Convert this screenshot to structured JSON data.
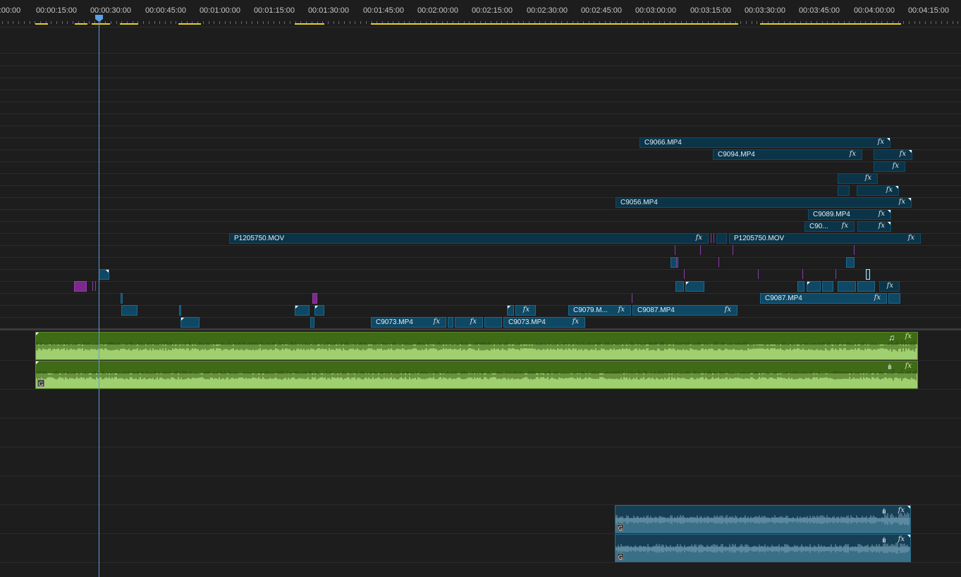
{
  "ruler": {
    "labels": [
      ":00:00",
      "00:00:15:00",
      "00:00:30:00",
      "00:00:45:00",
      "00:01:00:00",
      "00:01:15:00",
      "00:01:30:00",
      "00:01:45:00",
      "00:02:00:00",
      "00:02:15:00",
      "00:02:30:00",
      "00:02:45:00",
      "00:03:00:00",
      "00:03:15:00",
      "00:03:30:00",
      "00:03:45:00",
      "00:04:00:00",
      "00:04:15:00"
    ]
  },
  "playhead": {
    "time": "00:00:30:00"
  },
  "colors": {
    "video_clip": "#0e4865",
    "audio_clip_music": "#9fcf6e",
    "audio_clip_voice": "#3a6f88",
    "playhead": "#5b9fe6",
    "render_bar": "#e8d026",
    "marker": "#8d3ba5"
  },
  "clips": {
    "c9066": "C9066.MP4",
    "c9094": "C9094.MP4",
    "c9056": "C9056.MP4",
    "c9089": "C9089.MP4",
    "c90": "C90...",
    "p1205750_a": "P1205750.MOV",
    "p1205750_b": "P1205750.MOV",
    "c9087_upper": "C9087.MP4",
    "c9079": "C9079.M...",
    "c9087_lower": "C9087.MP4",
    "c9073_a": "C9073.MP4",
    "c9073_b": "C9073.MP4"
  },
  "fx_label": "fx",
  "audio": {
    "g_label": "G",
    "note_icon": "music-note-icon",
    "waveform_icon": "waveform-icon"
  }
}
